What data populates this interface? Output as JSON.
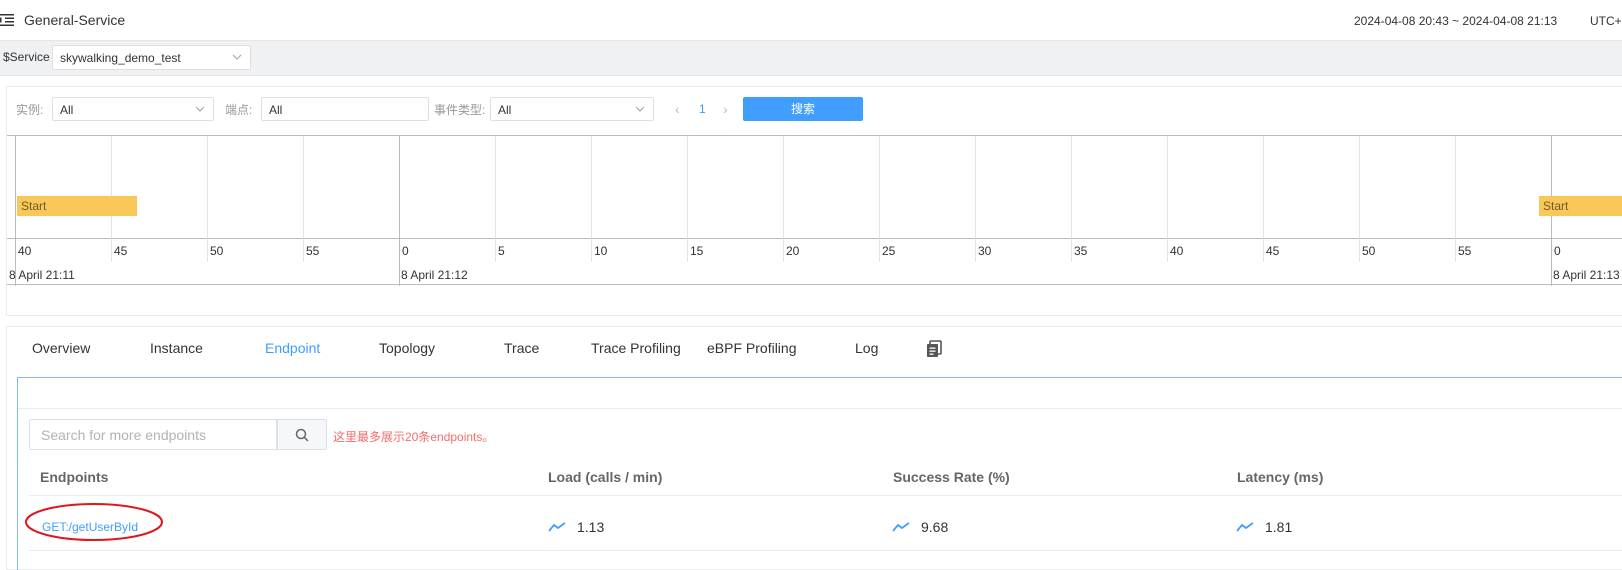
{
  "header": {
    "title": "General-Service",
    "time_range": "2024-04-08 20:43 ~ 2024-04-08 21:13",
    "timezone": "UTC+"
  },
  "service_bar": {
    "label": "$Service",
    "selected": "skywalking_demo_test"
  },
  "event_filters": {
    "instance_label": "实例:",
    "instance_value": "All",
    "endpoint_label": "端点:",
    "endpoint_value": "All",
    "event_type_label": "事件类型:",
    "event_type_value": "All",
    "page": "1",
    "search_button": "搜索"
  },
  "timeline": {
    "ticks": [
      "40",
      "45",
      "50",
      "55",
      "0",
      "5",
      "10",
      "15",
      "20",
      "25",
      "30",
      "35",
      "40",
      "45",
      "50",
      "55",
      "0"
    ],
    "dates": [
      "8 April 21:11",
      "8 April 21:12",
      "8 April 21:13"
    ],
    "events": [
      {
        "label": "Start"
      },
      {
        "label": "Start"
      }
    ]
  },
  "tabs": [
    {
      "label": "Overview"
    },
    {
      "label": "Instance"
    },
    {
      "label": "Endpoint",
      "active": true
    },
    {
      "label": "Topology"
    },
    {
      "label": "Trace"
    },
    {
      "label": "Trace Profiling"
    },
    {
      "label": "eBPF Profiling"
    },
    {
      "label": "Log"
    }
  ],
  "endpoint_list": {
    "search_placeholder": "Search for more endpoints",
    "note": "这里最多展示20条endpoints。",
    "columns": [
      "Endpoints",
      "Load (calls / min)",
      "Success Rate (%)",
      "Latency (ms)"
    ],
    "rows": [
      {
        "name": "GET:/getUserById",
        "load": "1.13",
        "success_rate": "9.68",
        "latency": "1.81"
      }
    ]
  },
  "colors": {
    "accent": "#409eff",
    "event_bar": "#fac858",
    "note_red": "#f56c6c",
    "annotation_red": "#e0161d"
  }
}
